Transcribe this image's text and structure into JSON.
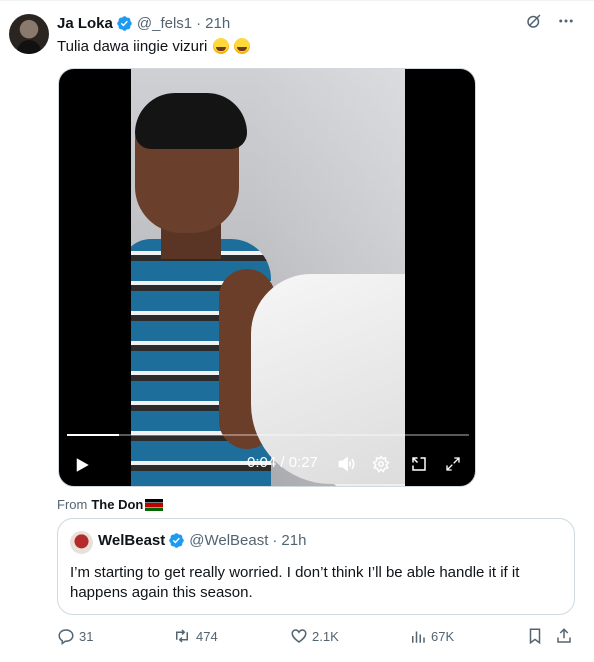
{
  "tweet": {
    "author_name": "Ja Loka",
    "handle": "@_fels1",
    "separator": "·",
    "time": "21h",
    "text": "Tulia dawa iingie vizuri"
  },
  "video": {
    "timecode": "0:04 / 0:27",
    "progress": 0.13
  },
  "source": {
    "prefix": "From",
    "name": "The Don"
  },
  "quote": {
    "author_name": "WelBeast",
    "handle": "@WelBeast",
    "separator": "·",
    "time": "21h",
    "text": "I’m starting to get really worried. I don’t think I’ll be able handle it if it happens again this season."
  },
  "actions": {
    "replies": "31",
    "reposts": "474",
    "likes": "2.1K",
    "views": "67K"
  },
  "colors": {
    "verified": "#1d9bf0",
    "secondary_text": "#536471",
    "border": "#cfd9de"
  }
}
